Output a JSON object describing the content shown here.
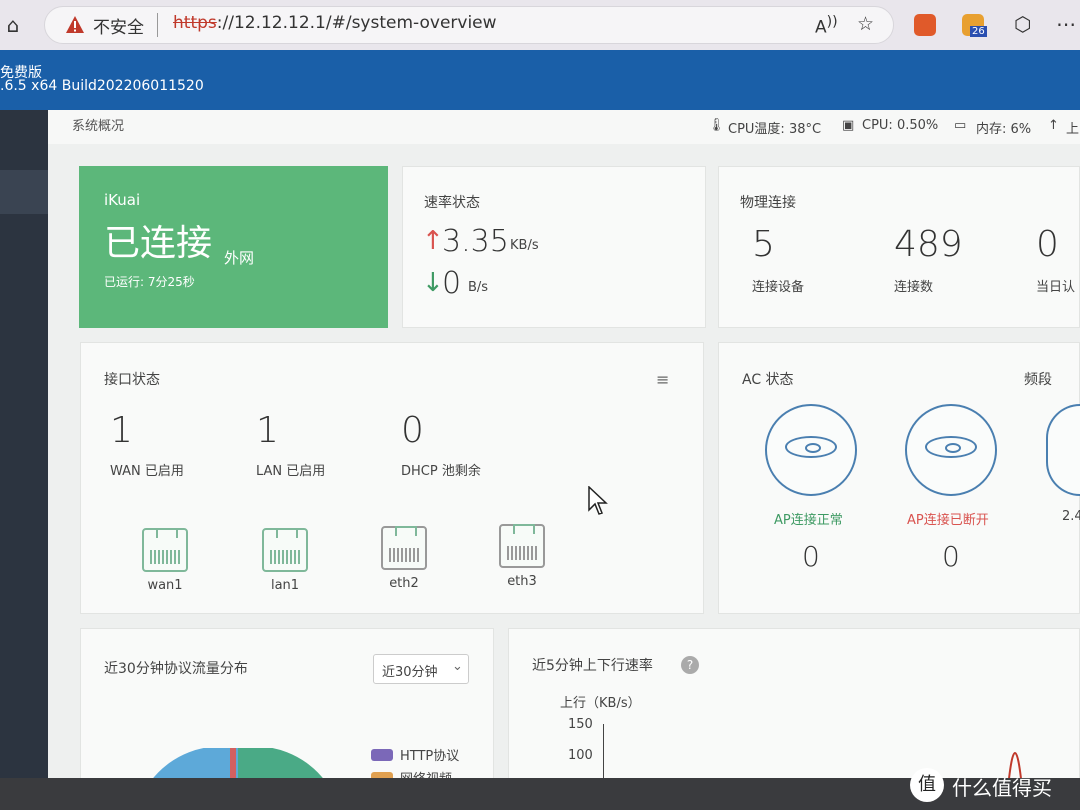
{
  "browser": {
    "security_label": "不安全",
    "url_scheme": "https",
    "url_rest": "://12.12.12.1/#/system-overview",
    "extension_badge": "26"
  },
  "app_header": {
    "line1": "免费版",
    "line2": ".6.5 x64 Build202206011520"
  },
  "breadcrumb": "系统概况",
  "status_bar": {
    "cpu_temp": "CPU温度: 38°C",
    "cpu": "CPU: 0.50%",
    "memory": "内存: 6%",
    "upload_partial": "上"
  },
  "connection_card": {
    "brand": "iKuai",
    "status": "已连接",
    "network": "外网",
    "uptime": "已运行: 7分25秒"
  },
  "rate_card": {
    "title": "速率状态",
    "up_value": "3.35",
    "up_unit": "KB/s",
    "down_value": "0",
    "down_unit": "B/s"
  },
  "physical_card": {
    "title": "物理连接",
    "items": [
      {
        "value": "5",
        "label": "连接设备"
      },
      {
        "value": "489",
        "label": "连接数"
      },
      {
        "value": "0",
        "label": "当日认"
      }
    ]
  },
  "interface_card": {
    "title": "接口状态",
    "counts": [
      {
        "value": "1",
        "label": "WAN 已启用"
      },
      {
        "value": "1",
        "label": "LAN 已启用"
      },
      {
        "value": "0",
        "label": "DHCP 池剩余"
      }
    ],
    "ports": [
      "wan1",
      "lan1",
      "eth2",
      "eth3"
    ]
  },
  "ac_card": {
    "title": "AC 状态",
    "band_title": "频段",
    "items": [
      {
        "label": "AP连接正常",
        "value": "0",
        "color": "#3e9a63"
      },
      {
        "label": "AP连接已断开",
        "value": "0",
        "color": "#d9534f"
      }
    ],
    "partial_label": "2.4"
  },
  "traffic_card": {
    "title": "近30分钟协议流量分布",
    "dropdown": "近30分钟",
    "legend": [
      {
        "label": "HTTP协议",
        "color": "#7b68b8"
      },
      {
        "label": "网络视频",
        "color": "#e0a050"
      }
    ]
  },
  "speed_card": {
    "title": "近5分钟上下行速率",
    "y_label": "上行（KB/s）",
    "ticks": [
      "150",
      "100"
    ]
  },
  "watermark": "什么值得买"
}
